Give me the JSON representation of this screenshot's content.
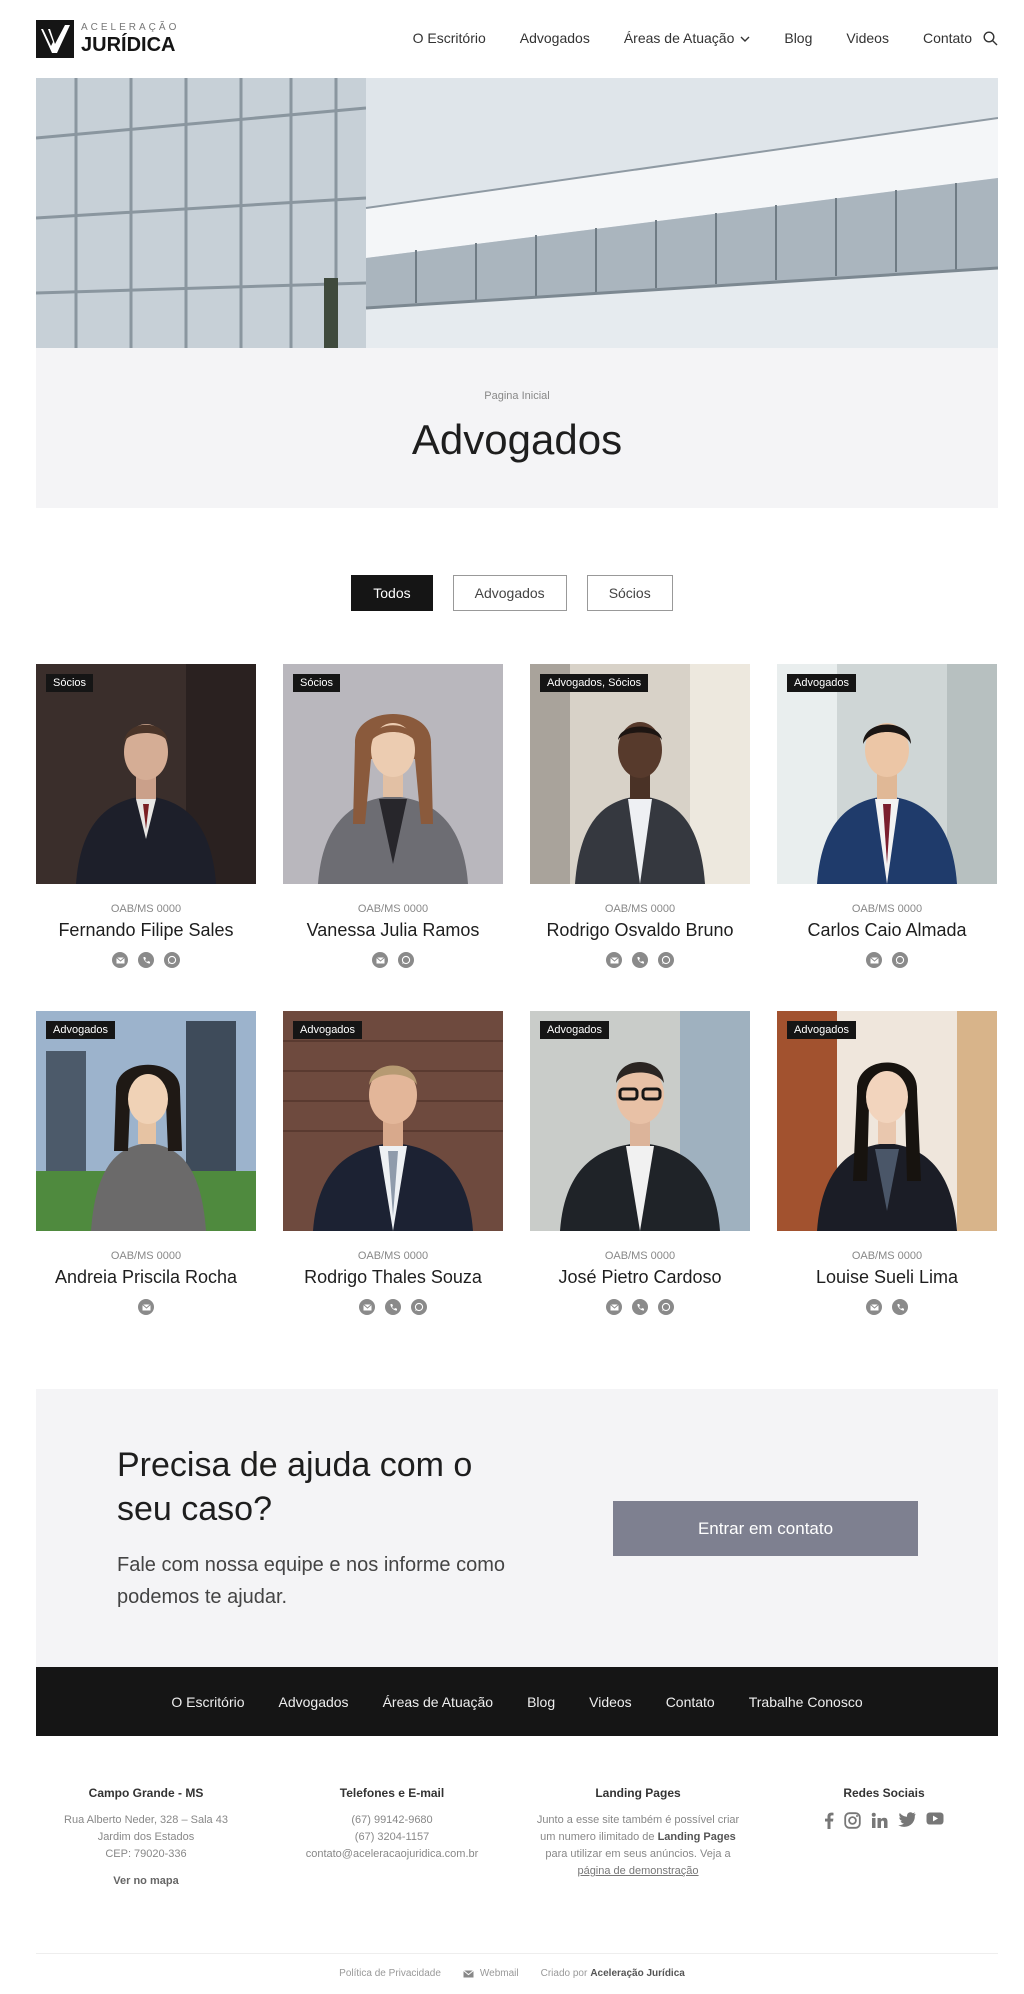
{
  "brand": {
    "top": "ACELERAÇÃO",
    "bottom": "JURÍDICA"
  },
  "nav": {
    "items": [
      "O Escritório",
      "Advogados",
      "Áreas de Atuação",
      "Blog",
      "Videos",
      "Contato"
    ]
  },
  "page": {
    "breadcrumb": "Pagina Inicial",
    "title": "Advogados"
  },
  "filters": [
    "Todos",
    "Advogados",
    "Sócios"
  ],
  "team": [
    {
      "tag": "Sócios",
      "oab": "OAB/MS 0000",
      "name": "Fernando Filipe Sales",
      "contacts": [
        "mail-icon",
        "phone-icon",
        "whatsapp-icon"
      ]
    },
    {
      "tag": "Sócios",
      "oab": "OAB/MS 0000",
      "name": "Vanessa Julia Ramos",
      "contacts": [
        "mail-icon",
        "whatsapp-icon"
      ]
    },
    {
      "tag": "Advogados, Sócios",
      "oab": "OAB/MS 0000",
      "name": "Rodrigo Osvaldo Bruno",
      "contacts": [
        "mail-icon",
        "phone-icon",
        "whatsapp-icon"
      ]
    },
    {
      "tag": "Advogados",
      "oab": "OAB/MS 0000",
      "name": "Carlos Caio Almada",
      "contacts": [
        "mail-icon",
        "whatsapp-icon"
      ]
    },
    {
      "tag": "Advogados",
      "oab": "OAB/MS 0000",
      "name": "Andreia Priscila Rocha",
      "contacts": [
        "mail-icon"
      ]
    },
    {
      "tag": "Advogados",
      "oab": "OAB/MS 0000",
      "name": "Rodrigo Thales Souza",
      "contacts": [
        "mail-icon",
        "phone-icon",
        "whatsapp-icon"
      ]
    },
    {
      "tag": "Advogados",
      "oab": "OAB/MS 0000",
      "name": "José Pietro Cardoso",
      "contacts": [
        "mail-icon",
        "phone-icon",
        "whatsapp-icon"
      ]
    },
    {
      "tag": "Advogados",
      "oab": "OAB/MS 0000",
      "name": "Louise Sueli Lima",
      "contacts": [
        "mail-icon",
        "phone-icon"
      ]
    }
  ],
  "cta": {
    "title": "Precisa de ajuda com o seu caso?",
    "text": "Fale com nossa equipe e nos informe como podemos te ajudar.",
    "button": "Entrar em contato"
  },
  "footer_nav": [
    "O Escritório",
    "Advogados",
    "Áreas de Atuação",
    "Blog",
    "Videos",
    "Contato",
    "Trabalhe Conosco"
  ],
  "footer": {
    "address": {
      "title": "Campo Grande - MS",
      "lines": [
        "Rua Alberto Neder, 328 – Sala 43",
        "Jardim dos Estados",
        "CEP: 79020-336"
      ],
      "link": "Ver no mapa"
    },
    "contact": {
      "title": "Telefones e E-mail",
      "lines": [
        "(67) 99142-9680",
        "(67) 3204-1157",
        "contato@aceleracaojuridica.com.br"
      ]
    },
    "landing": {
      "title": "Landing Pages",
      "text_a": "Junto a esse site também é possível criar um numero ilimitado de ",
      "bold": "Landing Pages",
      "text_b": " para utilizar em seus anúncios. Veja a ",
      "link": "página de demonstração"
    },
    "social": {
      "title": "Redes Sociais",
      "icons": [
        "facebook-icon",
        "instagram-icon",
        "linkedin-icon",
        "twitter-icon",
        "youtube-icon"
      ]
    }
  },
  "bottom_bar": {
    "privacy": "Política de Privacidade",
    "webmail": "Webmail",
    "created_prefix": "Criado por",
    "created_by": "Aceleração Jurídica"
  },
  "colors": {
    "dark": "#151515",
    "cta_button": "#7e8090",
    "band": "#f4f4f6",
    "icon_grey": "#8a8a8a"
  }
}
